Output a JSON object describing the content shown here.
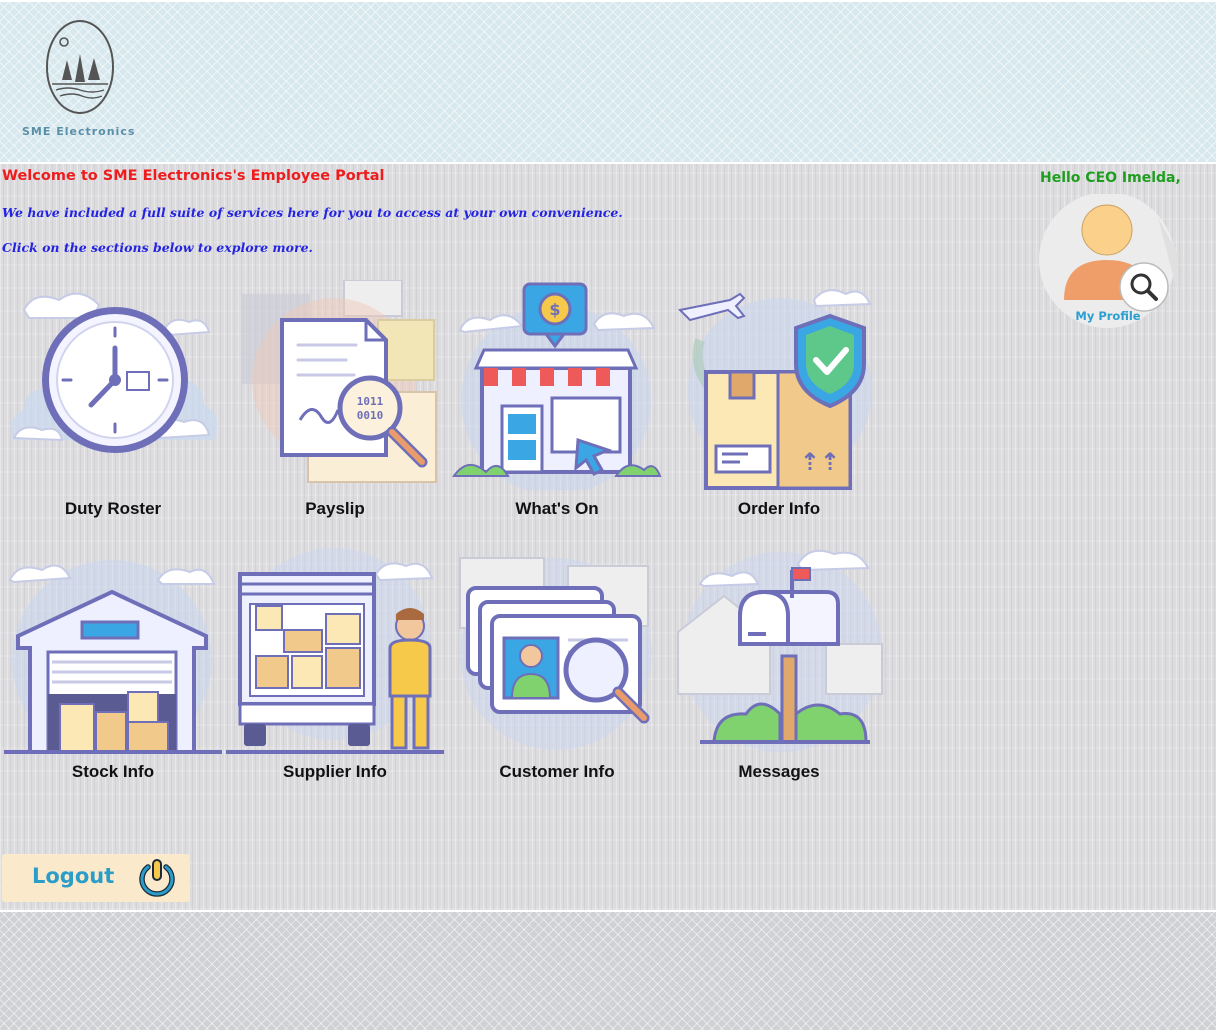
{
  "brand": {
    "name": "SME Electronics"
  },
  "greeting": {
    "welcome": "Welcome to SME Electronics's Employee Portal",
    "line1": "We have included a full suite of services here for you to access at your own convenience.",
    "line2": "Click on the sections below to explore more."
  },
  "user": {
    "hello": "Hello CEO Imelda,",
    "profile_label": "My Profile"
  },
  "tiles": [
    {
      "label": "Duty Roster",
      "icon": "clock-icon"
    },
    {
      "label": "Payslip",
      "icon": "document-magnifier-icon"
    },
    {
      "label": "What's On",
      "icon": "storefront-icon"
    },
    {
      "label": "Order Info",
      "icon": "shipping-box-icon"
    },
    {
      "label": "Stock Info",
      "icon": "warehouse-icon"
    },
    {
      "label": "Supplier Info",
      "icon": "delivery-truck-icon"
    },
    {
      "label": "Customer Info",
      "icon": "id-cards-icon"
    },
    {
      "label": "Messages",
      "icon": "mailbox-icon"
    }
  ],
  "logout": {
    "label": "Logout",
    "icon": "power-icon"
  },
  "colors": {
    "welcome": "#ee1c1c",
    "intro": "#2424e0",
    "hello": "#1e9e1e",
    "accent": "#2b9dc9"
  }
}
